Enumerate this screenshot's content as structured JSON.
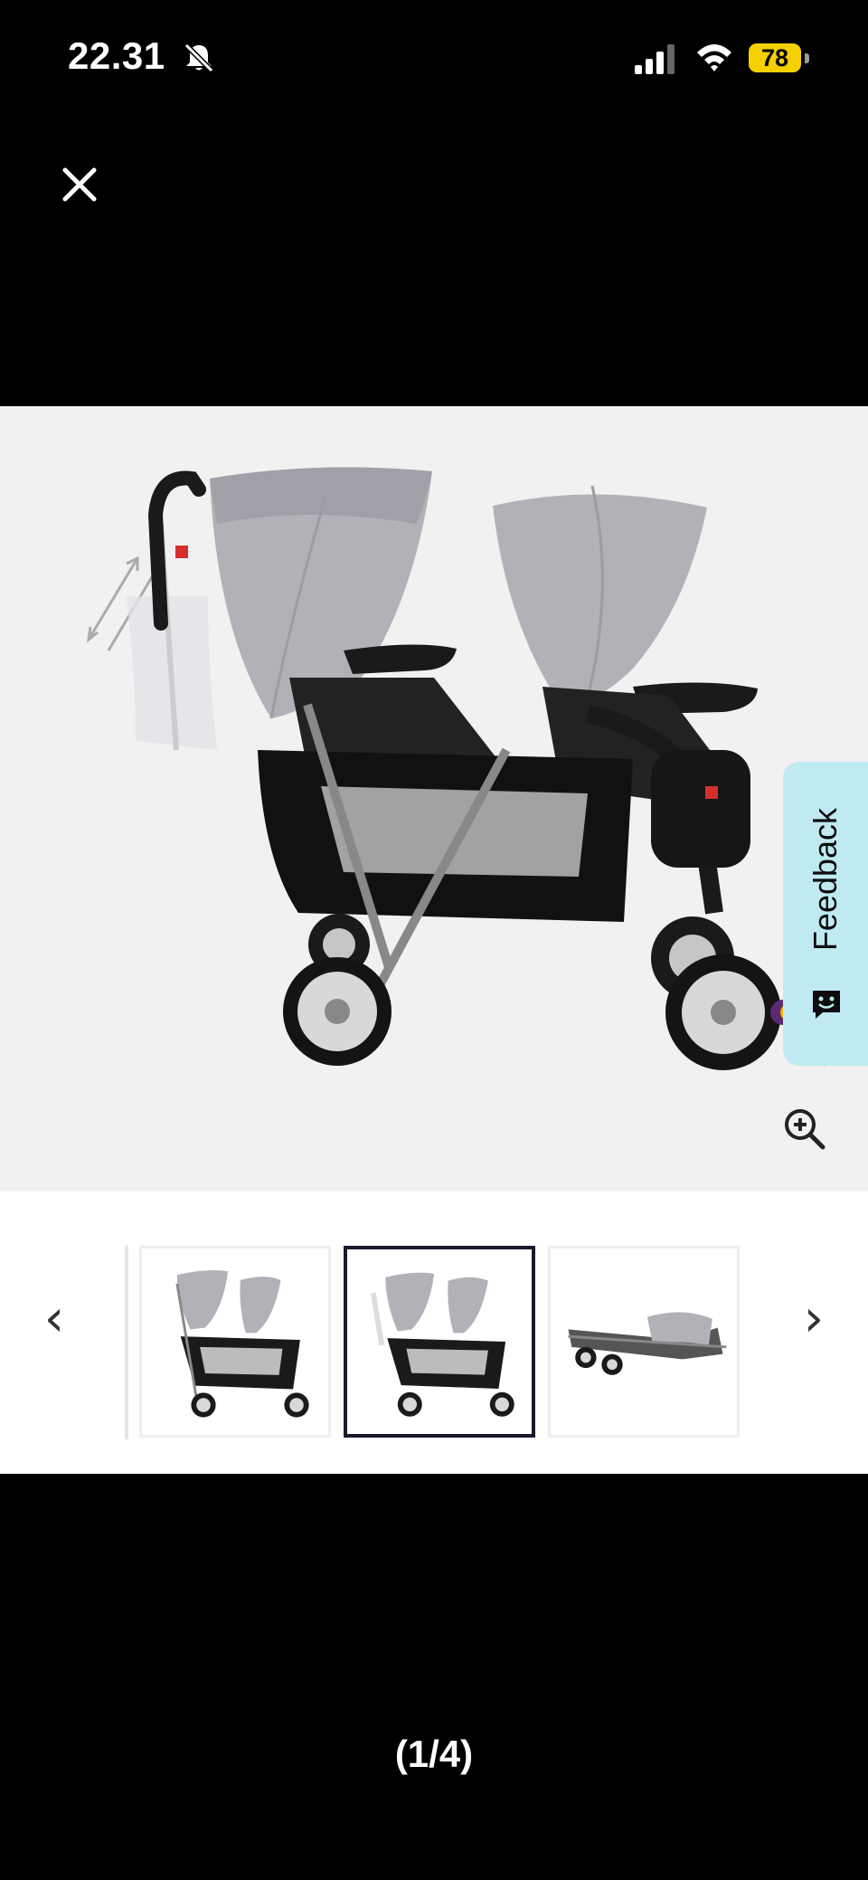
{
  "status_bar": {
    "time": "22.31",
    "battery_level": "78",
    "icons": [
      "bell-slash-icon",
      "cellular-signal-icon",
      "wifi-icon",
      "battery-icon"
    ]
  },
  "viewer": {
    "close_icon": "close-icon",
    "zoom_icon": "zoom-in-icon",
    "counter": "(1/4)"
  },
  "feedback": {
    "label": "Feedback"
  },
  "thumbnails": {
    "prev_arrow": "‹",
    "next_arrow": "›",
    "active_index": 1,
    "count_visible": 3
  },
  "colors": {
    "battery": "#f5d000",
    "feedback_bg": "#bfeaf2",
    "canopy": "#b3b1b8",
    "frame": "#1a1a1a"
  }
}
